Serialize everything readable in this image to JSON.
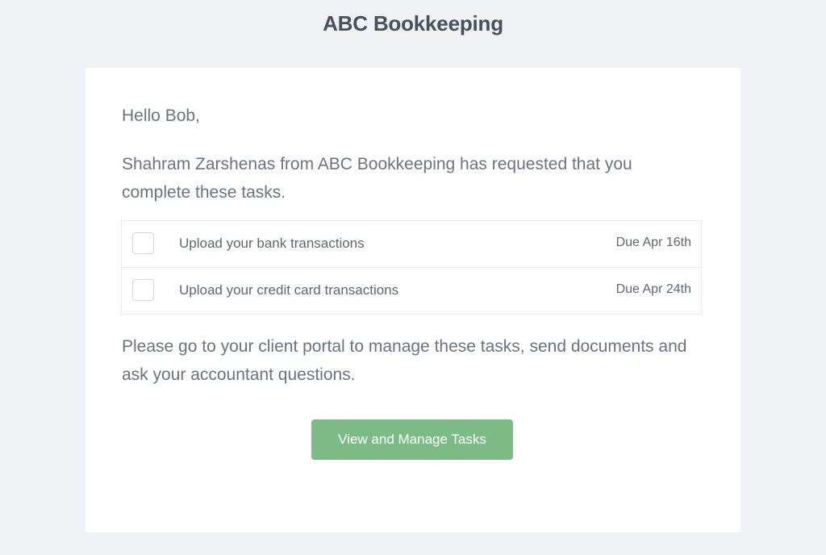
{
  "header": {
    "brand": "ABC Bookkeeping"
  },
  "email": {
    "greeting": "Hello Bob,",
    "intro": "Shahram Zarshenas from ABC Bookkeeping has requested that you complete these tasks.",
    "tasks": [
      {
        "label": "Upload your bank transactions",
        "due": "Due Apr 16th"
      },
      {
        "label": "Upload your credit card transactions",
        "due": "Due Apr 24th"
      }
    ],
    "portal_text": "Please go to your client portal to manage these tasks, send documents and ask your accountant questions.",
    "cta_label": "View and Manage Tasks"
  },
  "colors": {
    "background": "#f0f1f5",
    "card": "#ffffff",
    "button": "#7dbb86"
  }
}
